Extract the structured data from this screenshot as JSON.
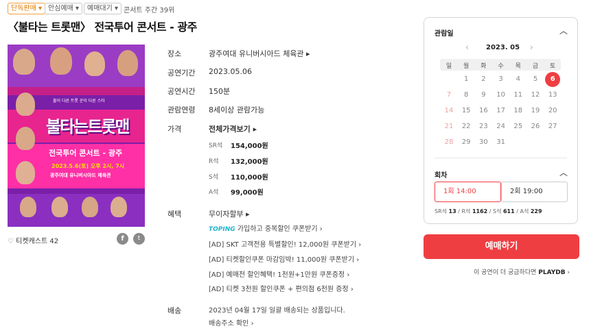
{
  "tags": [
    "단독판매",
    "안심예매",
    "예매대기"
  ],
  "rank": "콘서트 주간 39위",
  "title": "〈불타는 트롯맨〉 전국투어 콘서트 - 광주",
  "poster": {
    "tagline": "불이 다른 트롯 꾼이 다른 스타",
    "logo": "불타는트롯맨",
    "subtitle": "전국투어 콘서트 - 광주",
    "date_line": "2023.5.6(토) 오후 2시, 7시",
    "venue_line": "광주여대 유니버시아드 체육관"
  },
  "like": {
    "label": "티켓캐스트",
    "count": "42"
  },
  "info": {
    "venue_label": "장소",
    "venue": "광주여대 유니버시아드 체육관",
    "period_label": "공연기간",
    "period": "2023.05.06",
    "duration_label": "공연시간",
    "duration": "150분",
    "age_label": "관람연령",
    "age": "8세이상 관람가능",
    "price_label": "가격",
    "price_all": "전체가격보기",
    "prices": [
      {
        "grade": "SR석",
        "value": "154,000원"
      },
      {
        "grade": "R석",
        "value": "132,000원"
      },
      {
        "grade": "S석",
        "value": "110,000원"
      },
      {
        "grade": "A석",
        "value": "99,000원"
      }
    ],
    "benefit_label": "혜택",
    "benefit_main": "무이자할부",
    "toping": "TOPING",
    "toping_text": "가입하고 중복할인 쿠폰받기",
    "ads": [
      "[AD] SKT 고객전용 특별할인! 12,000원 쿠폰받기",
      "[AD] 티켓할인쿠폰 마감임박! 11,000원 쿠폰받기",
      "[AD] 예매전 할인혜택! 1천원+1만원 쿠폰증정",
      "[AD] 티켓 3천원 할인쿠폰 + 편의점 6천원 증정"
    ],
    "delivery_label": "배송",
    "delivery": "2023년 04월 17일 일괄 배송되는 상품입니다.",
    "delivery_link": "배송주소 확인"
  },
  "calendar": {
    "section_label": "관람일",
    "month": "2023. 05",
    "weekdays": [
      "일",
      "월",
      "화",
      "수",
      "목",
      "금",
      "토"
    ],
    "weeks": [
      [
        "",
        "1",
        "2",
        "3",
        "4",
        "5",
        "6"
      ],
      [
        "7",
        "8",
        "9",
        "10",
        "11",
        "12",
        "13"
      ],
      [
        "14",
        "15",
        "16",
        "17",
        "18",
        "19",
        "20"
      ],
      [
        "21",
        "22",
        "23",
        "24",
        "25",
        "26",
        "27"
      ],
      [
        "28",
        "29",
        "30",
        "31",
        "",
        "",
        ""
      ]
    ],
    "selected": "6"
  },
  "rounds": {
    "section_label": "회차",
    "options": [
      "1회 14:00",
      "2회 19:00"
    ],
    "seats": [
      {
        "grade": "SR석",
        "count": "13"
      },
      {
        "grade": "R석",
        "count": "1162"
      },
      {
        "grade": "S석",
        "count": "611"
      },
      {
        "grade": "A석",
        "count": "229"
      }
    ]
  },
  "book_button": "예매하기",
  "playdb_text": "이 공연이 더 궁금하다면",
  "playdb_logo": "PLAYDB",
  "colors": {
    "accent": "#ef3e42",
    "poster_bg": "#7a1fa8",
    "poster_pink": "#e8248f"
  }
}
